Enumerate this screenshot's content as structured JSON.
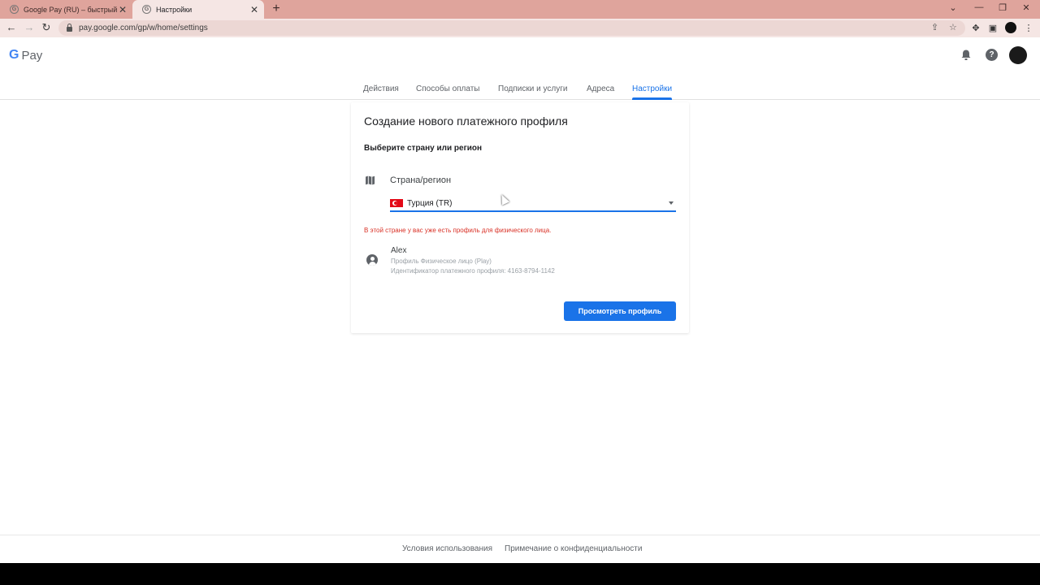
{
  "browser": {
    "tabs": [
      {
        "title": "Google Pay (RU) – быстрый и уд",
        "active": false
      },
      {
        "title": "Настройки",
        "active": true
      }
    ],
    "url": "pay.google.com/gp/w/home/settings",
    "tab_favicon": "G"
  },
  "header": {
    "logo_g": "G",
    "logo_text": "Pay"
  },
  "nav": {
    "tabs": [
      "Действия",
      "Способы оплаты",
      "Подписки и услуги",
      "Адреса",
      "Настройки"
    ],
    "active": "Настройки"
  },
  "card": {
    "title": "Создание нового платежного профиля",
    "subtitle": "Выберите страну или регион",
    "field_label": "Страна/регион",
    "selected_country": "Турция (TR)",
    "warning": "В этой стране у вас уже есть профиль для физического лица.",
    "profile": {
      "name": "Alex",
      "type": "Профиль Физическое лицо (Play)",
      "id_line": "Идентификатор платежного профиля: 4163-8794-1142"
    },
    "button_label": "Просмотреть профиль"
  },
  "footer": {
    "terms": "Условия использования",
    "privacy": "Примечание о конфиденциальности"
  },
  "colors": {
    "accent": "#1a73e8",
    "warning": "#d93025",
    "tabstrip": "#dfa49c"
  }
}
